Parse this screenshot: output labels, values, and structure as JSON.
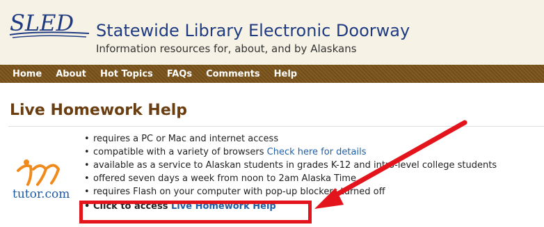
{
  "header": {
    "logo_text": "SLED",
    "title": "Statewide Library Electronic Doorway",
    "tagline": "Information resources for, about, and by Alaskans"
  },
  "nav": {
    "items": [
      "Home",
      "About",
      "Hot Topics",
      "FAQs",
      "Comments",
      "Help"
    ]
  },
  "page": {
    "title": "Live Homework Help"
  },
  "tutor_logo_text": "tutor.com",
  "features": [
    {
      "text": "requires a PC or Mac and internet access"
    },
    {
      "text": "compatible with a variety of browsers ",
      "link": "Check here for details"
    },
    {
      "text": "available as a service to Alaskan students in grades K-12 and intro-level college students"
    },
    {
      "text": "offered seven days a week from noon to 2am Alaska Time"
    },
    {
      "text": "requires Flash on your computer with pop-up blockers turned off"
    }
  ],
  "access": {
    "prefix": "Click to access ",
    "link": "Live Homework Help"
  },
  "colors": {
    "nav_bg": "#7a5219",
    "title_brown": "#6b3e11",
    "brand_blue": "#1f3b82",
    "link_blue": "#1f5fa6",
    "annotation_red": "#e3141b"
  }
}
